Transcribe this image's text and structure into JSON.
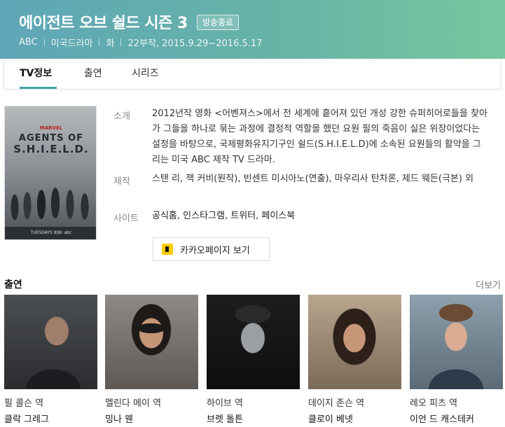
{
  "header": {
    "title": "에이전트 오브 쉴드 시즌 3",
    "status_badge": "방송종료",
    "meta": [
      "ABC",
      "미국드라마",
      "화",
      "22부작, 2015.9.29~2016.5.17"
    ]
  },
  "tabs": [
    {
      "label": "TV정보",
      "active": true
    },
    {
      "label": "출연",
      "active": false
    },
    {
      "label": "시리즈",
      "active": false
    }
  ],
  "poster": {
    "lines": [
      "MARVEL",
      "AGENTS OF",
      "S.H.I.E.L.D."
    ],
    "footer_text": "TUESDAYS 9|8c abc"
  },
  "info": {
    "intro_label": "소개",
    "intro_text": "2012년작 영화 <어벤져스>에서 전 세계에 흩어져 있던 개성 강한 슈퍼히어로들을 찾아가 그들을 하나로 묶는 과정에 결정적 역할을 했던 요원 필의 죽음이 실은 위장이었다는 설정을 바탕으로, 국제평화유지기구인 쉴드(S.H.I.E.L.D)에 소속된 요원들의 활약을 그리는 미국 ABC 제작 TV 드라마.",
    "production_label": "제작",
    "production_text": "스탠 리, 잭 커비(원작), 빈센트 미시아노(연출), 마우리사 탄차론, 제드 웨든(극본) 외",
    "site_label": "사이트",
    "sites": [
      "공식홈",
      "인스타그램",
      "트위터",
      "페이스북"
    ],
    "kakao_button": "카카오페이지 보기"
  },
  "cast_section": {
    "title": "출연",
    "more": "더보기",
    "members": [
      {
        "role": "필 콜슨 역",
        "actor": "클락 그레그"
      },
      {
        "role": "멜린다 메이 역",
        "actor": "밍나 웬"
      },
      {
        "role": "하이브 역",
        "actor": "브렛 돌튼"
      },
      {
        "role": "데이지 존슨 역",
        "actor": "클로이 베넷"
      },
      {
        "role": "레오 피츠 역",
        "actor": "이언 드 캐스테커"
      }
    ]
  },
  "colors": {
    "header_start": "#5fa6b8",
    "header_end": "#79c7a0",
    "tab_underline": "#3fa7a2",
    "kakao_yellow": "#ffcd00"
  }
}
